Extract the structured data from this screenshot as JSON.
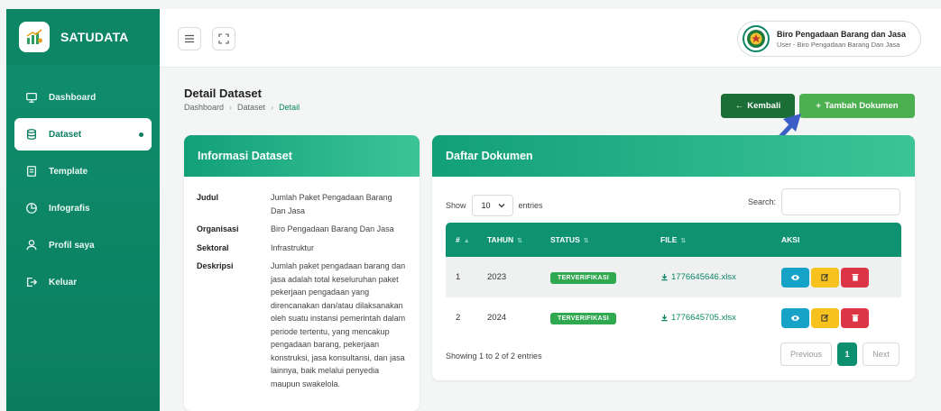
{
  "brand": {
    "title": "SATUDATA"
  },
  "sidebar": {
    "items": [
      {
        "label": "Dashboard",
        "icon": "monitor-icon",
        "active": false
      },
      {
        "label": "Dataset",
        "icon": "database-icon",
        "active": true
      },
      {
        "label": "Template",
        "icon": "document-icon",
        "active": false
      },
      {
        "label": "Infografis",
        "icon": "pie-chart-icon",
        "active": false
      },
      {
        "label": "Profil saya",
        "icon": "user-icon",
        "active": false
      },
      {
        "label": "Keluar",
        "icon": "logout-icon",
        "active": false
      }
    ]
  },
  "user": {
    "name": "Biro Pengadaan Barang dan Jasa",
    "role": "User - Biro Pengadaan Barang Dan Jasa"
  },
  "page": {
    "title": "Detail Dataset",
    "breadcrumb": [
      "Dashboard",
      "Dataset",
      "Detail"
    ]
  },
  "actions": {
    "back_label": "Kembali",
    "add_label": "Tambah Dokumen"
  },
  "info": {
    "heading": "Informasi Dataset",
    "rows": [
      {
        "key": "Judul",
        "value": "Jumlah Paket Pengadaan Barang Dan Jasa"
      },
      {
        "key": "Organisasi",
        "value": "Biro Pengadaan Barang Dan Jasa"
      },
      {
        "key": "Sektoral",
        "value": "Infrastruktur"
      },
      {
        "key": "Deskripsi",
        "value": "Jumlah paket pengadaan barang dan jasa adalah total keseluruhan paket pekerjaan pengadaan yang direncanakan dan/atau dilaksanakan oleh suatu instansi pemerintah dalam periode tertentu, yang mencakup pengadaan barang, pekerjaan konstruksi, jasa konsultansi, dan jasa lainnya, baik melalui penyedia maupun swakelola."
      }
    ]
  },
  "documents": {
    "heading": "Daftar Dokumen",
    "show_label": "Show",
    "entries_value": "10",
    "entries_label": "entries",
    "search_label": "Search:",
    "search_placeholder": "",
    "columns": [
      "#",
      "TAHUN",
      "STATUS",
      "FILE",
      "AKSI"
    ],
    "rows": [
      {
        "no": "1",
        "year": "2023",
        "status": "TERVERIFIKASI",
        "file": "1776645646.xlsx"
      },
      {
        "no": "2",
        "year": "2024",
        "status": "TERVERIFIKASI",
        "file": "1776645705.xlsx"
      }
    ],
    "footer": "Showing 1 to 2 of 2 entries",
    "pager": {
      "prev": "Previous",
      "current": "1",
      "next": "Next"
    }
  },
  "colors": {
    "primary": "#0d8666",
    "back_button": "#1b6e36",
    "add_button": "#4caf50",
    "badge": "#2fa84f",
    "view": "#17a2c8",
    "edit": "#f7c21d",
    "delete": "#dc3545",
    "annotation_arrow": "#3b5fc7"
  }
}
